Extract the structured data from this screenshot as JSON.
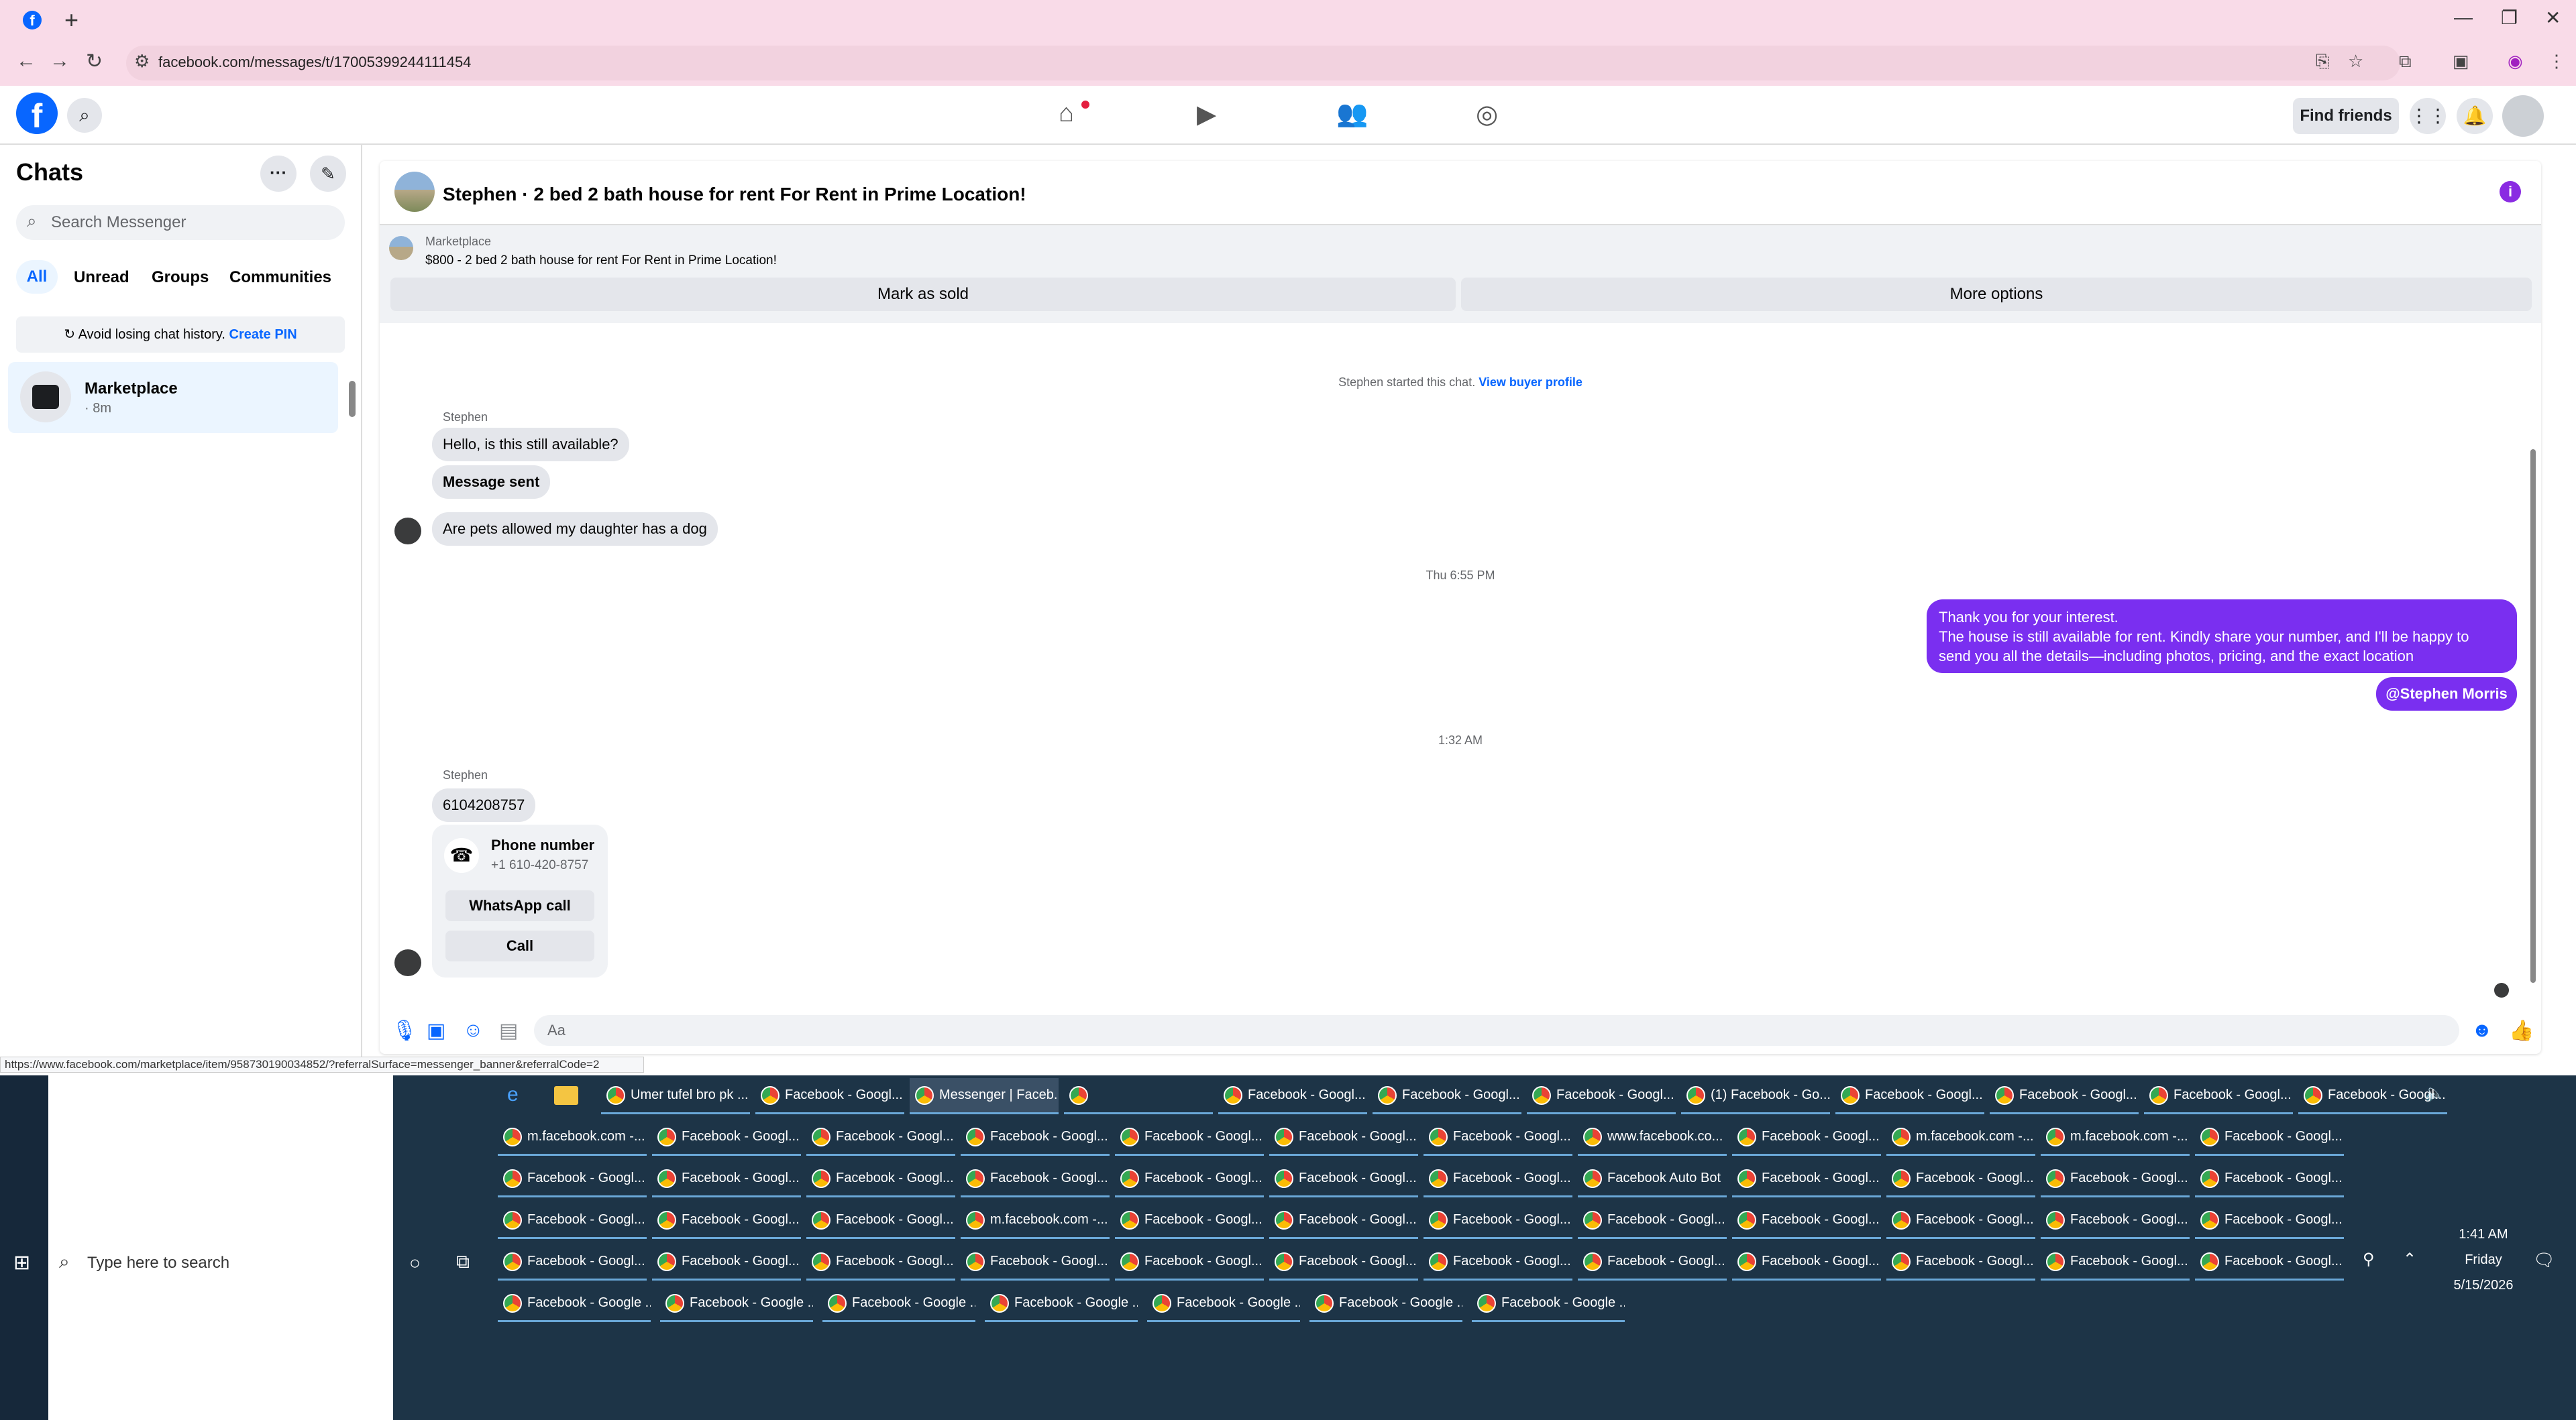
{
  "browser": {
    "url": "facebook.com/messages/t/17005399244111454",
    "status_url": "https://www.facebook.com/marketplace/item/958730190034852/?referralSurface=messenger_banner&referralCode=2"
  },
  "header": {
    "find_friends": "Find friends"
  },
  "sidebar": {
    "title": "Chats",
    "search_placeholder": "Search Messenger",
    "filters": [
      "All",
      "Unread",
      "Groups",
      "Communities"
    ],
    "pin_text": "Avoid losing chat history.",
    "pin_link": "Create PIN",
    "chat": {
      "name": "Marketplace",
      "time": "· 8m"
    }
  },
  "conversation": {
    "title": "Stephen · 2 bed 2 bath house for rent For Rent in Prime Location!",
    "marketplace_label": "Marketplace",
    "listing": "$800 - 2 bed 2 bath house for rent For Rent in Prime Location!",
    "mark_sold": "Mark as sold",
    "more_options": "More options",
    "started_note": "Stephen started this chat.",
    "view_profile": "View buyer profile",
    "sender1": "Stephen",
    "msg1": "Hello, is this still available?",
    "msg2": "Message sent",
    "msg3": "Are pets allowed my daughter has a dog",
    "time1": "Thu 6:55 PM",
    "out_line1": "Thank you for your interest.",
    "out_line2": "The house is still available for rent. Kindly share your number, and I'll be happy to",
    "out_line3": "send you all the details—including photos, pricing, and the exact location",
    "mention": "@Stephen Morris",
    "time2": "1:32 AM",
    "sender2": "Stephen",
    "phone_msg": "6104208757",
    "phone_title": "Phone number",
    "phone_number": "+1 610-420-8757",
    "whatsapp": "WhatsApp call",
    "call": "Call",
    "composer_placeholder": "Aa"
  },
  "taskbar": {
    "search": "Type here to search",
    "time": "1:41 AM",
    "day": "Friday",
    "date": "5/15/2026",
    "row1": [
      "Umer tufel bro pk ...",
      "Facebook - Googl...",
      "Messenger | Faceb...",
      "",
      "Facebook - Googl...",
      "Facebook - Googl...",
      "Facebook - Googl...",
      "(1) Facebook - Go...",
      "Facebook - Googl...",
      "Facebook - Googl...",
      "Facebook - Googl...",
      "Facebook - Googl..."
    ],
    "row2": [
      "m.facebook.com -...",
      "Facebook - Googl...",
      "Facebook - Googl...",
      "Facebook - Googl...",
      "Facebook - Googl...",
      "Facebook - Googl...",
      "Facebook - Googl...",
      "www.facebook.co...",
      "Facebook - Googl...",
      "m.facebook.com -...",
      "m.facebook.com -...",
      "Facebook - Googl..."
    ],
    "row3": [
      "Facebook - Googl...",
      "Facebook - Googl...",
      "Facebook - Googl...",
      "Facebook - Googl...",
      "Facebook - Googl...",
      "Facebook - Googl...",
      "Facebook - Googl...",
      "Facebook Auto Bot",
      "Facebook - Googl...",
      "Facebook - Googl...",
      "Facebook - Googl...",
      "Facebook - Googl..."
    ],
    "row4": [
      "Facebook - Googl...",
      "Facebook - Googl...",
      "Facebook - Googl...",
      "m.facebook.com -...",
      "Facebook - Googl...",
      "Facebook - Googl...",
      "Facebook - Googl...",
      "Facebook - Googl...",
      "Facebook - Googl...",
      "Facebook - Googl...",
      "Facebook - Googl...",
      "Facebook - Googl..."
    ],
    "row5": [
      "Facebook - Googl...",
      "Facebook - Googl...",
      "Facebook - Googl...",
      "Facebook - Googl...",
      "Facebook - Googl...",
      "Facebook - Googl...",
      "Facebook - Googl...",
      "Facebook - Googl...",
      "Facebook - Googl...",
      "Facebook - Googl...",
      "Facebook - Googl...",
      "Facebook - Googl..."
    ],
    "row6": [
      "Facebook - Google ...",
      "Facebook - Google ...",
      "Facebook - Google ...",
      "Facebook - Google ...",
      "Facebook - Google ...",
      "Facebook - Google ...",
      "Facebook - Google ..."
    ]
  },
  "colors": {
    "accent": "#0866ff",
    "outgoing": "#7a2ff0",
    "taskbar": "#1d3447"
  }
}
